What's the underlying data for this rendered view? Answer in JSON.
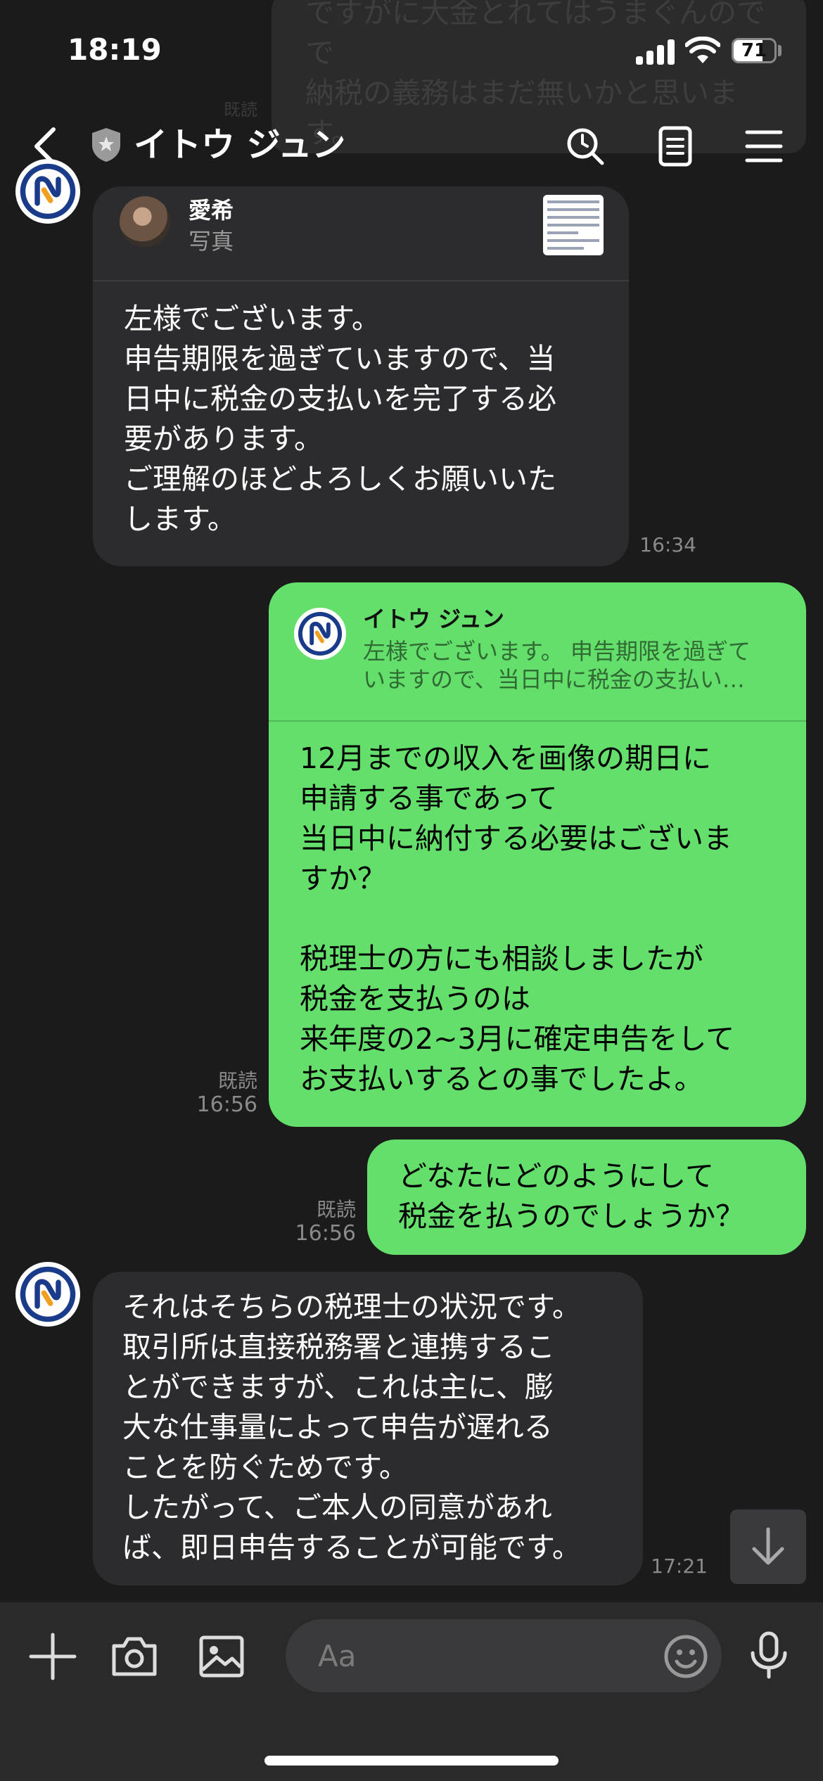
{
  "background_preview": {
    "text": "ですがに大金とれてはうまぐんので\nで\n納税の義務はまだ無いかと思いま\nす。",
    "read_label": "既読"
  },
  "status_bar": {
    "time": "18:19",
    "battery": "71",
    "battery_fraction": 0.71
  },
  "header": {
    "title": "イトウ ジュン"
  },
  "messages": [
    {
      "quote_name": "愛希",
      "quote_sub": "写真",
      "text": "左様でございます。\n申告期限を過ぎていますので、当\n日中に税金の支払いを完了する必\n要があります。\nご理解のほどよろしくお願いいた\nします。",
      "time": "16:34"
    },
    {
      "quote_name": "イトウ ジュン",
      "quote_sub": "左様でございます。 申告期限を過ぎて\nいますので、当日中に税金の支払い…",
      "text": "12月までの収入を画像の期日に\n申請する事であって\n当日中に納付する必要はございま\nすか？\n\n税理士の方にも相談しましたが\n税金を支払うのは\n来年度の2~3月に確定申告をして\nお支払いするとの事でしたよ。",
      "read": "既読",
      "time": "16:56"
    },
    {
      "text": "どなたにどのようにして\n税金を払うのでしょうか？",
      "read": "既読",
      "time": "16:56"
    },
    {
      "text": "それはそちらの税理士の状況です。\n取引所は直接税務署と連携するこ\nとができますが、これは主に、膨\n大な仕事量によって申告が遅れる\nことを防ぐためです。\nしたがって、ご本人の同意があれ\nば、即日申告することが可能です。",
      "time": "17:21"
    }
  ],
  "input": {
    "placeholder": "Aa"
  },
  "colors": {
    "outgoing_bubble": "#64df6c",
    "incoming_bubble": "#2c2c2e",
    "background": "#1b1b1b"
  }
}
